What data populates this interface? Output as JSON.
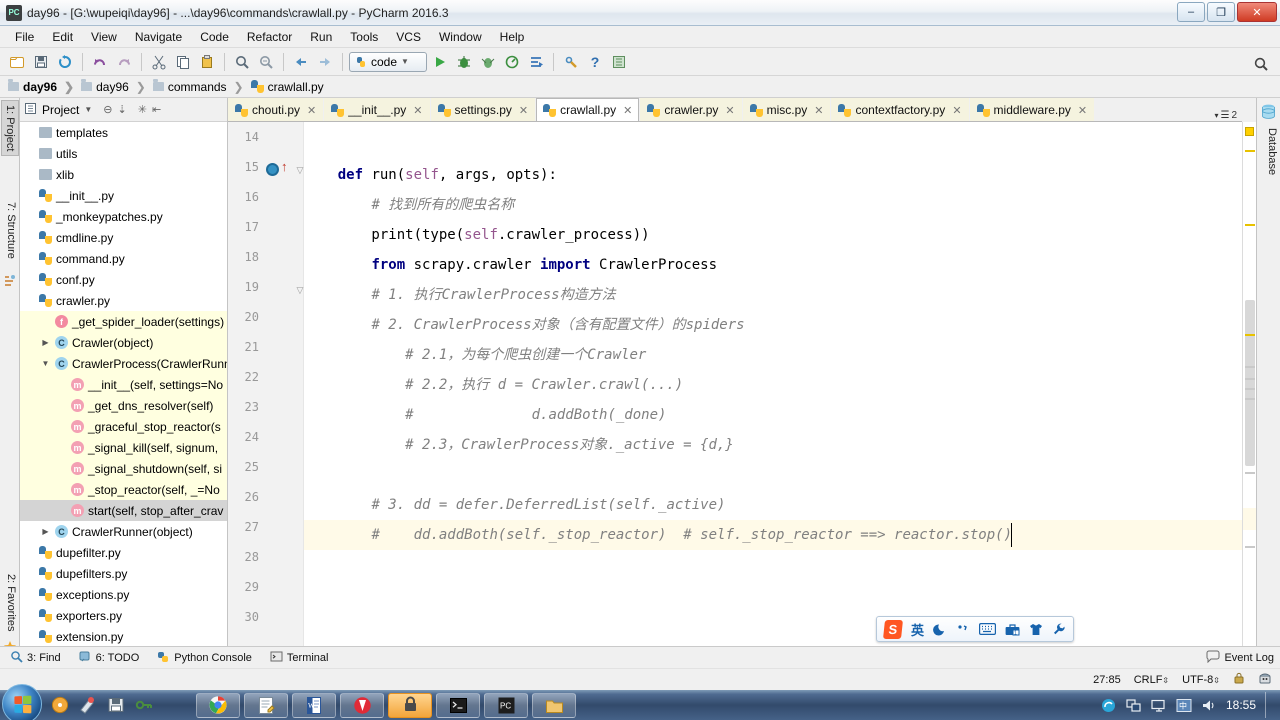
{
  "window": {
    "title": "day96 - [G:\\wupeiqi\\day96] - ...\\day96\\commands\\crawlall.py - PyCharm 2016.3",
    "app_icon": "pycharm-icon",
    "buttons": {
      "minimize": "–",
      "maximize": "❐",
      "close": "✕"
    }
  },
  "menubar": {
    "items": [
      "File",
      "Edit",
      "View",
      "Navigate",
      "Code",
      "Refactor",
      "Run",
      "Tools",
      "VCS",
      "Window",
      "Help"
    ]
  },
  "toolbar": {
    "run_config": "code",
    "icons": [
      "open-folder-icon",
      "save-all-icon",
      "sync-icon",
      "undo-icon",
      "redo-icon",
      "cut-icon",
      "copy-icon",
      "paste-icon",
      "find-icon",
      "replace-icon",
      "back-icon",
      "forward-icon"
    ],
    "run_icons": [
      "run-icon",
      "debug-icon",
      "coverage-icon",
      "profile-icon",
      "run-with-console-icon",
      "attach-icon"
    ],
    "help_icon": "help-icon",
    "settings_icon": "settings-icon",
    "search_everywhere_icon": "search-icon"
  },
  "navbar": {
    "crumbs": [
      "day96",
      "day96",
      "commands",
      "crawlall.py"
    ]
  },
  "project_panel": {
    "title": "Project",
    "header_icons": [
      "project-view-icon",
      "chevron-down-icon",
      "collapse-all-icon",
      "expand-icon",
      "settings-gear-icon",
      "hide-icon"
    ],
    "tree": [
      {
        "label": "templates",
        "kind": "folder",
        "indent": 1,
        "arrow": "",
        "highlight": false
      },
      {
        "label": "utils",
        "kind": "folder",
        "indent": 1,
        "arrow": "",
        "highlight": false
      },
      {
        "label": "xlib",
        "kind": "folder",
        "indent": 1,
        "arrow": "",
        "highlight": false
      },
      {
        "label": "__init__.py",
        "kind": "python",
        "indent": 1,
        "arrow": "",
        "highlight": false
      },
      {
        "label": "_monkeypatches.py",
        "kind": "python",
        "indent": 1,
        "arrow": "",
        "highlight": false
      },
      {
        "label": "cmdline.py",
        "kind": "python",
        "indent": 1,
        "arrow": "",
        "highlight": false
      },
      {
        "label": "command.py",
        "kind": "python",
        "indent": 1,
        "arrow": "",
        "highlight": false
      },
      {
        "label": "conf.py",
        "kind": "python",
        "indent": 1,
        "arrow": "",
        "highlight": false
      },
      {
        "label": "crawler.py",
        "kind": "python",
        "indent": 1,
        "arrow": "",
        "highlight": false
      },
      {
        "label": "_get_spider_loader(settings)",
        "kind": "function",
        "indent": 2,
        "arrow": "",
        "highlight": true
      },
      {
        "label": "Crawler(object)",
        "kind": "class",
        "indent": 2,
        "arrow": "▶",
        "highlight": true
      },
      {
        "label": "CrawlerProcess(CrawlerRunn",
        "kind": "class",
        "indent": 2,
        "arrow": "▼",
        "highlight": true
      },
      {
        "label": "__init__(self, settings=No",
        "kind": "method",
        "indent": 3,
        "arrow": "",
        "highlight": true
      },
      {
        "label": "_get_dns_resolver(self)",
        "kind": "method",
        "indent": 3,
        "arrow": "",
        "highlight": true
      },
      {
        "label": "_graceful_stop_reactor(s",
        "kind": "method",
        "indent": 3,
        "arrow": "",
        "highlight": true
      },
      {
        "label": "_signal_kill(self, signum, ",
        "kind": "method",
        "indent": 3,
        "arrow": "",
        "highlight": true
      },
      {
        "label": "_signal_shutdown(self, si",
        "kind": "method",
        "indent": 3,
        "arrow": "",
        "highlight": true
      },
      {
        "label": "_stop_reactor(self, _=No",
        "kind": "method",
        "indent": 3,
        "arrow": "",
        "highlight": true
      },
      {
        "label": "start(self, stop_after_crav",
        "kind": "method",
        "indent": 3,
        "arrow": "",
        "highlight": false,
        "selected": true
      },
      {
        "label": "CrawlerRunner(object)",
        "kind": "class",
        "indent": 2,
        "arrow": "▶",
        "highlight": false
      },
      {
        "label": "dupefilter.py",
        "kind": "python",
        "indent": 1,
        "arrow": "",
        "highlight": false
      },
      {
        "label": "dupefilters.py",
        "kind": "python",
        "indent": 1,
        "arrow": "",
        "highlight": false
      },
      {
        "label": "exceptions.py",
        "kind": "python",
        "indent": 1,
        "arrow": "",
        "highlight": false
      },
      {
        "label": "exporters.py",
        "kind": "python",
        "indent": 1,
        "arrow": "",
        "highlight": false
      },
      {
        "label": "extension.py",
        "kind": "python",
        "indent": 1,
        "arrow": "",
        "highlight": false
      }
    ]
  },
  "left_tool_tabs": [
    {
      "label": "1: Project",
      "selected": true,
      "icon": "project-icon"
    },
    {
      "label": "7: Structure",
      "selected": false,
      "icon": "structure-icon"
    },
    {
      "label": "2: Favorites",
      "selected": false,
      "icon": "favorites-star-icon"
    }
  ],
  "right_tool_tabs": [
    {
      "label": "Database",
      "icon": "database-icon"
    }
  ],
  "editor_tabs": [
    {
      "label": "chouti.py",
      "active": false
    },
    {
      "label": "__init__.py",
      "active": false
    },
    {
      "label": "settings.py",
      "active": false
    },
    {
      "label": "crawlall.py",
      "active": true
    },
    {
      "label": "crawler.py",
      "active": false
    },
    {
      "label": "misc.py",
      "active": false
    },
    {
      "label": "contextfactory.py",
      "active": false
    },
    {
      "label": "middleware.py",
      "active": false
    }
  ],
  "editor_tab_overflow": "2",
  "editor": {
    "first_line": 14,
    "caret_line": 27,
    "lines": [
      {
        "num": 14,
        "text": ""
      },
      {
        "num": 15,
        "text": "    def run(self, args, opts):",
        "gutter": "breakpoint-and-override",
        "fold": "▽"
      },
      {
        "num": 16,
        "text": "        # 找到所有的爬虫名称"
      },
      {
        "num": 17,
        "text": "        print(type(self.crawler_process))"
      },
      {
        "num": 18,
        "text": "        from scrapy.crawler import CrawlerProcess"
      },
      {
        "num": 19,
        "text": "        # 1. 执行CrawlerProcess构造方法",
        "fold": "▽"
      },
      {
        "num": 20,
        "text": "        # 2. CrawlerProcess对象（含有配置文件）的spiders"
      },
      {
        "num": 21,
        "text": "            # 2.1，为每个爬虫创建一个Crawler"
      },
      {
        "num": 22,
        "text": "            # 2.2，执行 d = Crawler.crawl(...)"
      },
      {
        "num": 23,
        "text": "            #              d.addBoth(_done)"
      },
      {
        "num": 24,
        "text": "            # 2.3，CrawlerProcess对象._active = {d,}"
      },
      {
        "num": 25,
        "text": ""
      },
      {
        "num": 26,
        "text": "        # 3. dd = defer.DeferredList(self._active)"
      },
      {
        "num": 27,
        "text": "        #    dd.addBoth(self._stop_reactor)  # self._stop_reactor ==> reactor.stop()"
      },
      {
        "num": 28,
        "text": ""
      },
      {
        "num": 29,
        "text": ""
      },
      {
        "num": 30,
        "text": ""
      }
    ]
  },
  "ime_toolbar": {
    "logo": "S",
    "mode": "英",
    "icons": [
      "moon-icon",
      "punctuation-icon",
      "keyboard-icon",
      "toolbox-icon",
      "skin-shirt-icon",
      "wrench-icon"
    ]
  },
  "status_bar": {
    "left_items": [
      {
        "label": "3: Find",
        "icon": "find-icon"
      },
      {
        "label": "6: TODO",
        "icon": "todo-icon"
      },
      {
        "label": "Python Console",
        "icon": "python-console-icon"
      },
      {
        "label": "Terminal",
        "icon": "terminal-icon"
      }
    ],
    "event_log": {
      "label": "Event Log",
      "icon": "event-log-icon"
    },
    "caret_position": "27:85",
    "line_separator": "CRLF",
    "encoding": "UTF-8",
    "lock_icon": "lock-icon",
    "inspection_icon": "hector-inspector-icon"
  },
  "taskbar": {
    "start_label": "Start",
    "quick_launch": [
      "media-player-icon",
      "paint-icon",
      "save-icon",
      "key-tool-icon"
    ],
    "tasks": [
      "chrome-icon",
      "notepad-icon",
      "word-icon",
      "video-player-icon",
      "pycharm-box-icon",
      "cmd-icon",
      "pycharm-icon",
      "explorer-icon"
    ],
    "tray": [
      "sogou-tray-icon",
      "network-share-icon",
      "monitor-icon",
      "ime-tray-icon",
      "volume-icon"
    ],
    "clock": "18:55"
  },
  "colors": {
    "accent_blue": "#3592c4",
    "comment_gray": "#808080",
    "keyword_navy": "#000080",
    "self_purple": "#94558d",
    "caret_line": "#fffae8",
    "tree_highlight": "#ffffe0",
    "taskbar_blue": "#2a4a74",
    "ime_orange": "#ff5722",
    "inspection_yellow": "#ffd000"
  }
}
